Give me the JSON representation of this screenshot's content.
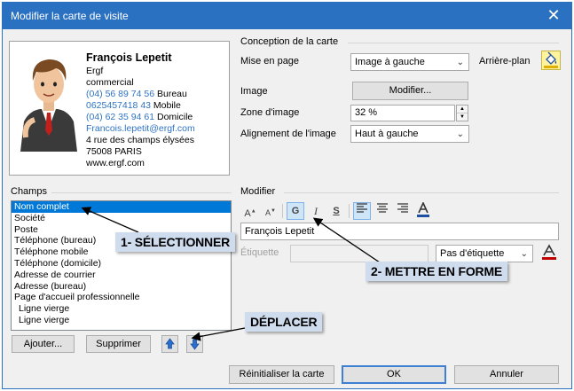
{
  "window": {
    "title": "Modifier la carte de visite"
  },
  "card": {
    "name": "François Lepetit",
    "company": "Ergf",
    "job_title": "commercial",
    "phones": [
      {
        "number": "(04) 56 89 74 56",
        "label": "Bureau"
      },
      {
        "number": "0625457418 43",
        "label": "Mobile"
      },
      {
        "number": "(04) 62 35 94 61",
        "label": "Domicile"
      }
    ],
    "email": "Francois.lepetit@ergf.com",
    "address_line1": "4 rue des champs élysées",
    "address_line2": "75008 PARIS",
    "website": "www.ergf.com"
  },
  "design": {
    "heading": "Conception de la carte",
    "layout_label": "Mise en page",
    "layout_value": "Image à gauche",
    "background_label": "Arrière-plan",
    "image_label": "Image",
    "image_button": "Modifier...",
    "image_area_label": "Zone d'image",
    "image_area_value": "32 %",
    "image_align_label": "Alignement de l'image",
    "image_align_value": "Haut à gauche"
  },
  "fields": {
    "heading": "Champs",
    "items": [
      "Nom complet",
      "Société",
      "Poste",
      "Téléphone (bureau)",
      "Téléphone mobile",
      "Téléphone (domicile)",
      "Adresse de courrier",
      "Adresse (bureau)",
      "Page d'accueil professionnelle",
      "Ligne vierge",
      "Ligne vierge"
    ],
    "add_button": "Ajouter...",
    "delete_button": "Supprimer"
  },
  "edit": {
    "heading": "Modifier",
    "bold": "G",
    "italic": "I",
    "underline": "S",
    "text_value": "François Lepetit",
    "label_label": "Étiquette",
    "label_option": "Pas d'étiquette"
  },
  "footer": {
    "reset_button": "Réinitialiser la carte",
    "ok_button": "OK",
    "cancel_button": "Annuler"
  },
  "annotations": {
    "select": "1- SÉLECTIONNER",
    "format": "2- METTRE EN FORME",
    "move": "DÉPLACER"
  },
  "colors": {
    "titlebar": "#2b71c2",
    "selection": "#0078d7",
    "link_blue": "#2e74c4",
    "annotation_bg": "#cfdcee"
  }
}
